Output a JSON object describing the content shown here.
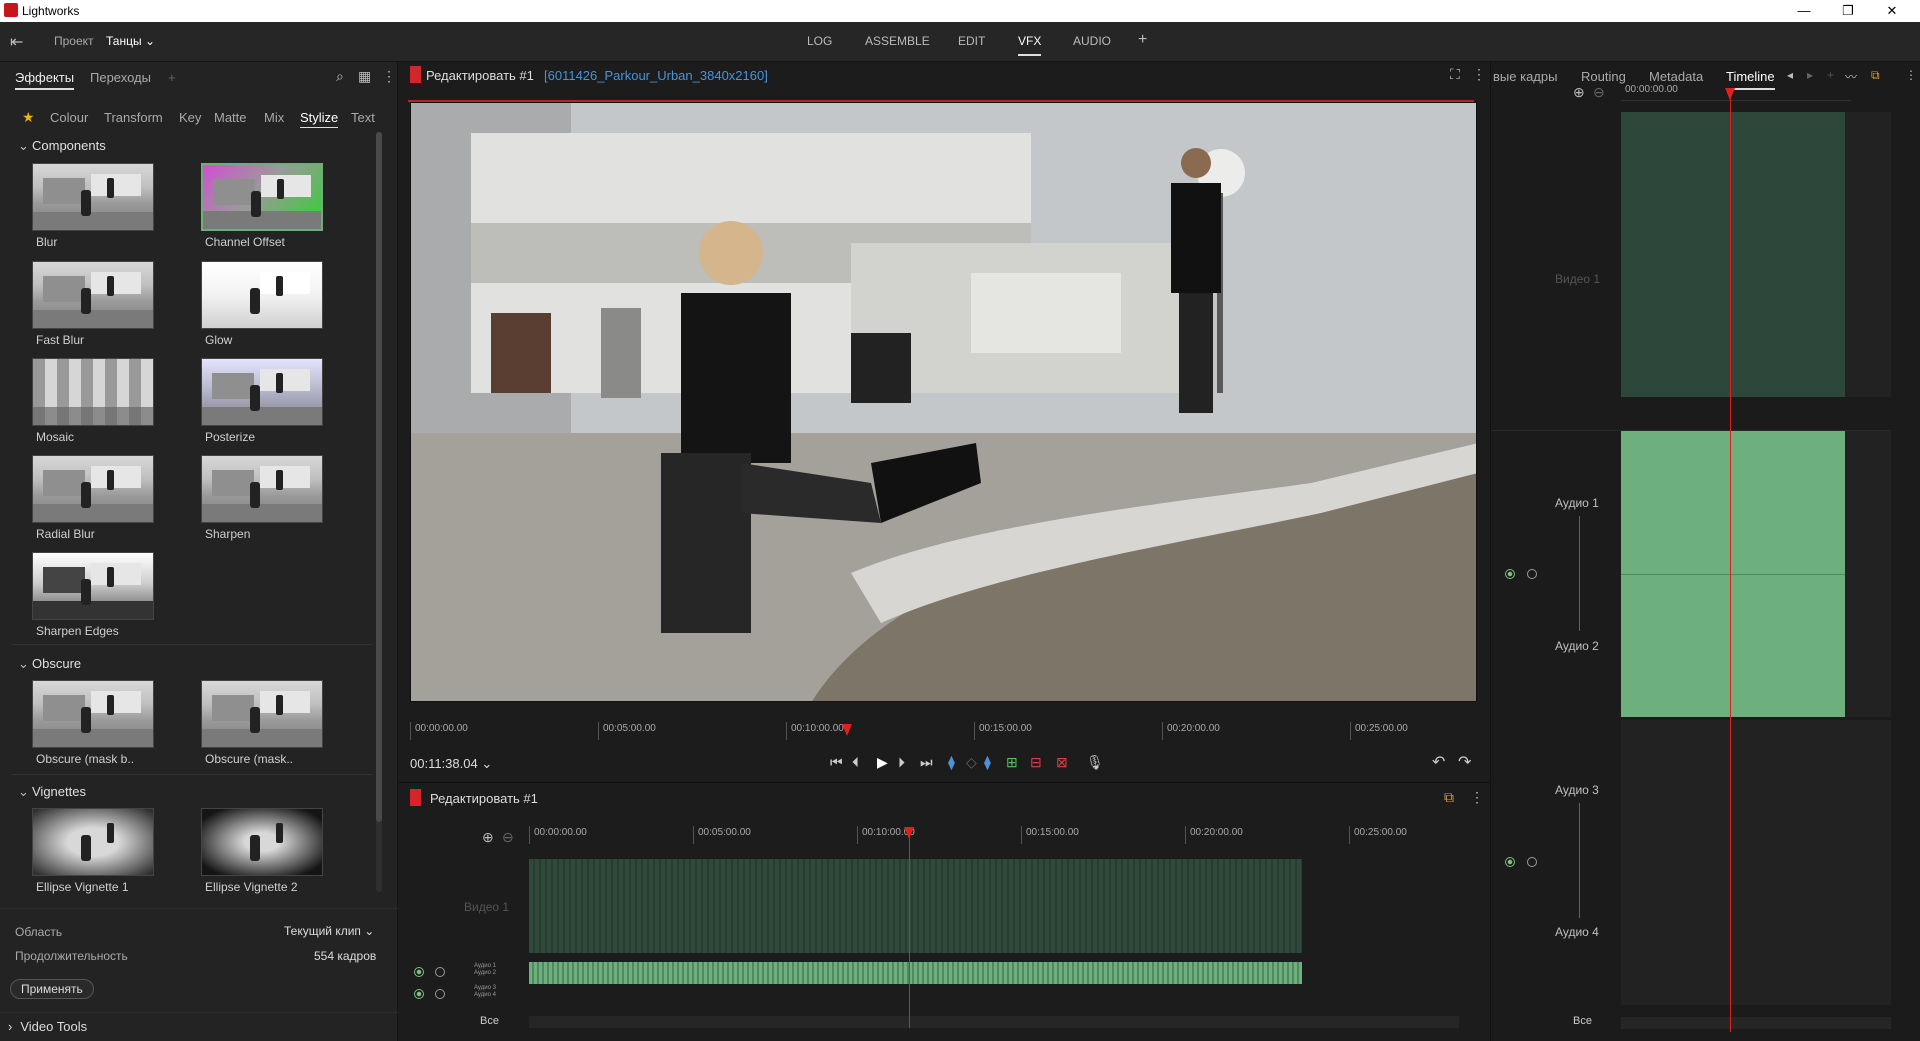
{
  "window": {
    "title": "Lightworks",
    "minimize": "—",
    "maximize": "❐",
    "close": "✕"
  },
  "menubar": {
    "project_label": "Проект",
    "project_name": "Танцы",
    "tabs": [
      "LOG",
      "ASSEMBLE",
      "EDIT",
      "VFX",
      "AUDIO"
    ],
    "active_tab": "VFX",
    "add": "+"
  },
  "left": {
    "tabs": [
      "Эффекты",
      "Переходы"
    ],
    "add": "+",
    "categories": [
      "Colour",
      "Transform",
      "Key",
      "Matte",
      "Mix",
      "Stylize",
      "Text"
    ],
    "active_category": "Stylize",
    "sections": {
      "components": "Components",
      "obscure": "Obscure",
      "vignettes": "Vignettes"
    },
    "effects": [
      "Blur",
      "Channel Offset",
      "Fast Blur",
      "Glow",
      "Mosaic",
      "Posterize",
      "Radial Blur",
      "Sharpen",
      "Sharpen Edges"
    ],
    "obscure_effects": [
      "Obscure (mask b..",
      "Obscure (mask.."
    ],
    "vignette_effects": [
      "Ellipse Vignette 1",
      "Ellipse Vignette 2"
    ],
    "area_label": "Область",
    "area_value": "Текущий клип",
    "duration_label": "Продолжительность",
    "duration_value": "554 кадров",
    "apply": "Применять",
    "video_tools": "Video Tools"
  },
  "viewer": {
    "title": "Редактировать #1",
    "clip": "[6011426_Parkour_Urban_3840x2160]",
    "ruler": [
      "00:00:00.00",
      "00:05:00.00",
      "00:10:00.00",
      "00:15:00.00",
      "00:20:00.00",
      "00:25:00.00"
    ],
    "timecode": "00:11:38.04",
    "playhead_fraction": 0.41
  },
  "timeline": {
    "title": "Редактировать #1",
    "ruler": [
      "00:00:00.00",
      "00:05:00.00",
      "00:10:00.00",
      "00:15:00.00",
      "00:20:00.00",
      "00:25:00.00"
    ],
    "video_track": "Видео 1",
    "audio_tracks_a": [
      "Аудио 1",
      "Аудио 2"
    ],
    "audio_tracks_b": [
      "Аудио 3",
      "Аудио 4"
    ],
    "all": "Все"
  },
  "right": {
    "tabs": [
      "вые кадры",
      "Routing",
      "Metadata",
      "Timeline"
    ],
    "active_tab": "Timeline",
    "ruler_time": "00:00:00.00",
    "tracks": [
      "Видео 1",
      "Аудио 1",
      "Аудио 2",
      "Аудио 3",
      "Аудио 4"
    ],
    "all": "Все"
  },
  "colors": {
    "accent_red": "#e02020",
    "clip_video": "#2f4a3a",
    "clip_audio": "#6db07e"
  }
}
